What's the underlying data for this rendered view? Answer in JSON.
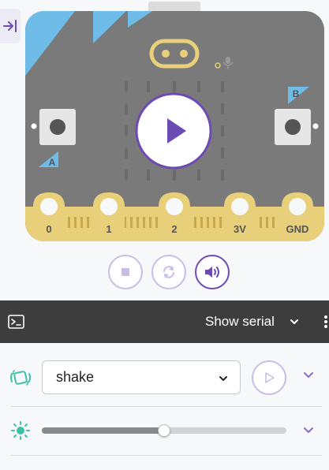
{
  "colors": {
    "board": "#7a7a7a",
    "corner": "#6fbce8",
    "pins": "#e8d07a",
    "accent": "#6c4bb5",
    "accent_light": "#c9bde6",
    "serial_bar": "#3d3d3d",
    "gesture_icon": "#3fbfa6"
  },
  "sim": {
    "collapse_icon": "collapse-sidebar-icon",
    "button_a": "A",
    "button_b": "B",
    "pins": [
      "0",
      "1",
      "2",
      "3V",
      "GND"
    ],
    "play_icon": "play-icon",
    "mic_icon": "microphone-icon",
    "led_level": 0,
    "controls": {
      "stop_icon": "stop-icon",
      "restart_icon": "restart-icon",
      "sound_icon": "speaker-icon"
    }
  },
  "serial": {
    "terminal_icon": "terminal-icon",
    "label": "Show serial",
    "chevron_icon": "chevron-down-icon",
    "more_icon": "more-vertical-icon"
  },
  "gesture": {
    "icon": "gesture-icon",
    "selected": "shake",
    "send_icon": "send-icon",
    "expand_icon": "chevron-down-icon"
  },
  "light": {
    "icon": "sun-icon",
    "level": 0.5,
    "expand_icon": "chevron-down-icon"
  }
}
